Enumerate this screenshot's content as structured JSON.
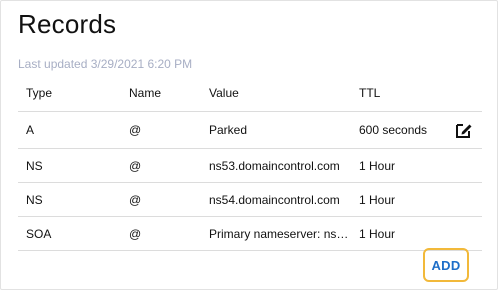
{
  "card": {
    "title": "Records",
    "last_updated": "Last updated 3/29/2021 6:20 PM"
  },
  "table": {
    "columns": [
      "Type",
      "Name",
      "Value",
      "TTL"
    ],
    "rows": [
      {
        "type": "A",
        "name": "@",
        "value": "Parked",
        "ttl": "600 seconds",
        "editable": true
      },
      {
        "type": "NS",
        "name": "@",
        "value": "ns53.domaincontrol.com",
        "ttl": "1 Hour",
        "editable": false
      },
      {
        "type": "NS",
        "name": "@",
        "value": "ns54.domaincontrol.com",
        "ttl": "1 Hour",
        "editable": false
      },
      {
        "type": "SOA",
        "name": "@",
        "value": "Primary nameserver: ns5...",
        "ttl": "1 Hour",
        "editable": false
      }
    ]
  },
  "actions": {
    "add_label": "ADD",
    "edit_icon": "edit-pencil-icon"
  },
  "colors": {
    "accent": "#1e6ec8",
    "highlight": "#f2b93a",
    "muted_text": "#a7aec4"
  }
}
